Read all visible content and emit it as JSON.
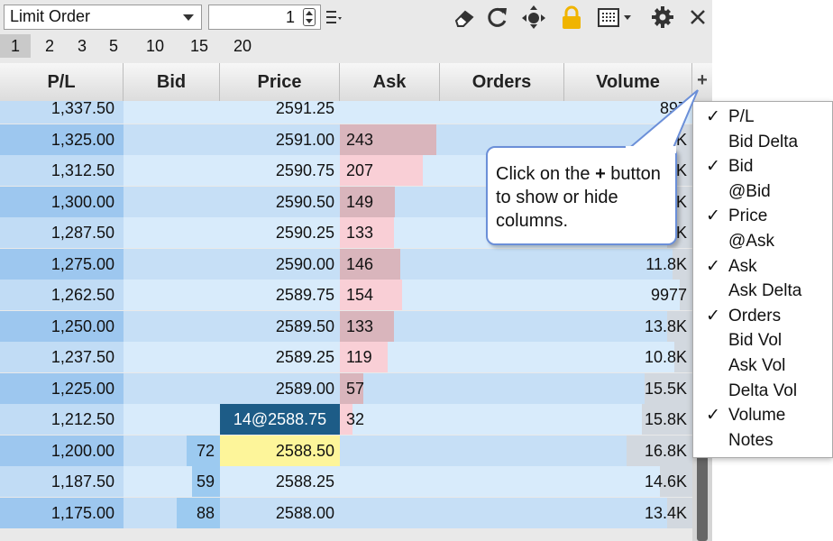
{
  "toolbar": {
    "order_type": "Limit Order",
    "quantity": "1",
    "icons": [
      "eraser-icon",
      "refresh-icon",
      "center-icon",
      "lock-icon",
      "layout-icon",
      "gear-icon",
      "close-icon"
    ]
  },
  "quick_qty": [
    "1",
    "2",
    "3",
    "5",
    "10",
    "15",
    "20"
  ],
  "columns": [
    "P/L",
    "Bid",
    "Price",
    "Ask",
    "Orders",
    "Volume"
  ],
  "plus_label": "+",
  "rows": [
    {
      "pl": "1,337.50",
      "bid": "",
      "price": "2591.25",
      "ask": "",
      "vol": "897",
      "ask_frac": 0,
      "bid_frac": 0,
      "vol_frac": 0.0
    },
    {
      "pl": "1,325.00",
      "bid": "",
      "price": "2591.00",
      "ask": "243",
      "vol": "12.8K",
      "ask_frac": 0.96,
      "bid_frac": 0,
      "vol_frac": 0.1
    },
    {
      "pl": "1,312.50",
      "bid": "",
      "price": "2590.75",
      "ask": "207",
      "vol": "14.5K",
      "ask_frac": 0.83,
      "bid_frac": 0,
      "vol_frac": 0.1
    },
    {
      "pl": "1,300.00",
      "bid": "",
      "price": "2590.50",
      "ask": "149",
      "vol": "13.9K",
      "ask_frac": 0.55,
      "bid_frac": 0,
      "vol_frac": 0.1
    },
    {
      "pl": "1,287.50",
      "bid": "",
      "price": "2590.25",
      "ask": "133",
      "vol": "12.9K",
      "ask_frac": 0.54,
      "bid_frac": 0,
      "vol_frac": 0.1
    },
    {
      "pl": "1,275.00",
      "bid": "",
      "price": "2590.00",
      "ask": "146",
      "vol": "11.8K",
      "ask_frac": 0.6,
      "bid_frac": 0,
      "vol_frac": 0.08
    },
    {
      "pl": "1,262.50",
      "bid": "",
      "price": "2589.75",
      "ask": "154",
      "vol": "9977",
      "ask_frac": 0.62,
      "bid_frac": 0,
      "vol_frac": 0.05
    },
    {
      "pl": "1,250.00",
      "bid": "",
      "price": "2589.50",
      "ask": "133",
      "vol": "13.8K",
      "ask_frac": 0.54,
      "bid_frac": 0,
      "vol_frac": 0.1
    },
    {
      "pl": "1,237.50",
      "bid": "",
      "price": "2589.25",
      "ask": "119",
      "vol": "10.8K",
      "ask_frac": 0.48,
      "bid_frac": 0,
      "vol_frac": 0.07
    },
    {
      "pl": "1,225.00",
      "bid": "",
      "price": "2589.00",
      "ask": "57",
      "vol": "15.5K",
      "ask_frac": 0.23,
      "bid_frac": 0,
      "vol_frac": 0.19
    },
    {
      "pl": "1,212.50",
      "bid": "",
      "price": "14@2588.75",
      "ask": "32",
      "vol": "15.8K",
      "ask_frac": 0.13,
      "bid_frac": 0,
      "vol_frac": 0.2,
      "current": true
    },
    {
      "pl": "1,200.00",
      "bid": "72",
      "price": "2588.50",
      "ask": "",
      "vol": "16.8K",
      "ask_frac": 0,
      "bid_frac": 0.35,
      "vol_frac": 0.26,
      "best_bid": true
    },
    {
      "pl": "1,187.50",
      "bid": "59",
      "price": "2588.25",
      "ask": "",
      "vol": "14.6K",
      "ask_frac": 0,
      "bid_frac": 0.29,
      "vol_frac": 0.13
    },
    {
      "pl": "1,175.00",
      "bid": "88",
      "price": "2588.00",
      "ask": "",
      "vol": "13.4K",
      "ask_frac": 0,
      "bid_frac": 0.45,
      "vol_frac": 0.1
    }
  ],
  "menu": [
    {
      "label": "P/L",
      "checked": true
    },
    {
      "label": "Bid Delta",
      "checked": false
    },
    {
      "label": "Bid",
      "checked": true
    },
    {
      "label": "@Bid",
      "checked": false
    },
    {
      "label": "Price",
      "checked": true
    },
    {
      "label": "@Ask",
      "checked": false
    },
    {
      "label": "Ask",
      "checked": true
    },
    {
      "label": "Ask Delta",
      "checked": false
    },
    {
      "label": "Orders",
      "checked": true
    },
    {
      "label": "Bid Vol",
      "checked": false
    },
    {
      "label": "Ask Vol",
      "checked": false
    },
    {
      "label": "Delta Vol",
      "checked": false
    },
    {
      "label": "Volume",
      "checked": true
    },
    {
      "label": "Notes",
      "checked": false
    }
  ],
  "check_glyph": "✓",
  "callout": {
    "pre": "Click on the ",
    "bold": "+",
    "post": " button to show or hide columns."
  },
  "colors": {
    "row_light": "#d8ebfb",
    "row_dark": "#c6dff6",
    "pl_light": "#c1dcf5",
    "pl_dark": "#9dc7ef",
    "ask_bar": "#f9cfd6",
    "ask_bar_dark": "#d9b5bc",
    "bid_bar": "#9ccaf0",
    "current": "#1d5c87",
    "best_bid": "#fdf59a",
    "vol_bar": "#d2d8df"
  }
}
